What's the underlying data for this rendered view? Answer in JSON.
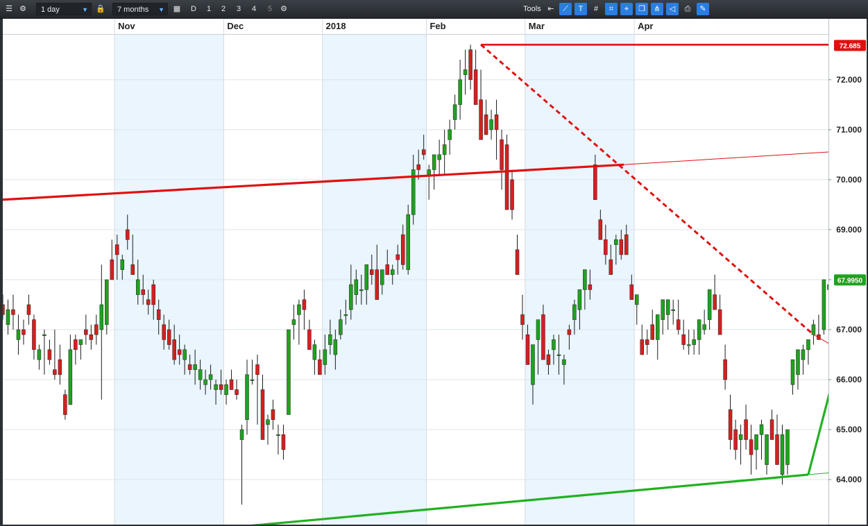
{
  "toolbar": {
    "interval": "1 day",
    "period": "7 months",
    "tools_label": "Tools",
    "period_buttons": [
      "D",
      "1",
      "2",
      "3",
      "4",
      "5"
    ]
  },
  "colors": {
    "up": "#1fa21f",
    "down": "#d42020",
    "resistance": "#e01010",
    "support": "#22b022",
    "band": "#eaf5fd",
    "grid": "#dde3ea"
  },
  "chart_data": {
    "type": "candlestick",
    "x_labels": [
      "Nov",
      "Dec",
      "2018",
      "Feb",
      "Mar",
      "Apr"
    ],
    "y_ticks": [
      "64.000",
      "65.000",
      "66.000",
      "67.000",
      "68.000",
      "69.000",
      "70.000",
      "71.000",
      "72.000"
    ],
    "ylim": [
      63.1,
      72.9
    ],
    "price_tags": [
      {
        "label": "72.685",
        "value": 72.685,
        "color": "#e01010"
      },
      {
        "label": "67.9950",
        "value": 67.995,
        "color": "#1fa21f"
      }
    ],
    "month_starts": [
      22,
      43,
      62,
      82,
      101,
      122
    ],
    "shaded_months": [
      [
        22,
        43
      ],
      [
        62,
        82
      ],
      [
        101,
        122
      ]
    ],
    "candles": [
      [
        67.5,
        67.7,
        67.2,
        67.3
      ],
      [
        67.1,
        67.6,
        66.9,
        67.4
      ],
      [
        67.4,
        67.7,
        67.0,
        67.3
      ],
      [
        66.8,
        67.3,
        66.5,
        67.0
      ],
      [
        67.0,
        67.2,
        66.7,
        66.9
      ],
      [
        67.5,
        67.7,
        67.1,
        67.3
      ],
      [
        67.2,
        67.3,
        66.4,
        66.6
      ],
      [
        66.4,
        66.7,
        66.2,
        66.6
      ],
      [
        66.9,
        67.0,
        66.1,
        66.9
      ],
      [
        66.6,
        66.8,
        66.3,
        66.4
      ],
      [
        66.2,
        67.0,
        66.0,
        66.1
      ],
      [
        66.4,
        66.7,
        65.9,
        66.1
      ],
      [
        65.7,
        65.8,
        65.2,
        65.3
      ],
      [
        65.5,
        66.9,
        65.5,
        66.6
      ],
      [
        66.8,
        66.9,
        66.3,
        66.6
      ],
      [
        66.7,
        66.8,
        66.4,
        66.8
      ],
      [
        67.0,
        67.3,
        66.7,
        66.9
      ],
      [
        66.9,
        67.1,
        66.6,
        66.8
      ],
      [
        67.1,
        67.3,
        66.7,
        66.9
      ],
      [
        67.0,
        68.3,
        65.6,
        67.5
      ],
      [
        67.1,
        68.0,
        66.9,
        68.0
      ],
      [
        68.4,
        68.8,
        68.1,
        68.0
      ],
      [
        68.7,
        68.9,
        68.0,
        68.5
      ],
      [
        68.2,
        68.5,
        68.0,
        68.4
      ],
      [
        69.0,
        69.3,
        68.6,
        68.8
      ],
      [
        68.3,
        68.9,
        68.1,
        68.1
      ],
      [
        67.7,
        68.4,
        67.5,
        68.0
      ],
      [
        67.8,
        68.1,
        67.5,
        67.7
      ],
      [
        67.6,
        67.8,
        67.3,
        67.5
      ],
      [
        67.9,
        68.0,
        67.2,
        67.5
      ],
      [
        67.4,
        67.6,
        66.9,
        67.2
      ],
      [
        67.1,
        67.3,
        66.6,
        66.8
      ],
      [
        67.0,
        67.2,
        66.6,
        66.7
      ],
      [
        66.8,
        67.1,
        66.3,
        66.4
      ],
      [
        66.6,
        66.9,
        66.3,
        66.5
      ],
      [
        66.4,
        66.7,
        66.1,
        66.6
      ],
      [
        66.3,
        66.5,
        66.1,
        66.2
      ],
      [
        66.2,
        66.6,
        65.9,
        66.3
      ],
      [
        66.0,
        66.4,
        65.8,
        66.2
      ],
      [
        65.9,
        66.2,
        65.7,
        66.0
      ],
      [
        66.0,
        66.3,
        65.8,
        66.1
      ],
      [
        65.8,
        66.0,
        65.5,
        65.9
      ],
      [
        65.9,
        66.2,
        65.7,
        65.8
      ],
      [
        65.7,
        66.0,
        65.5,
        65.9
      ],
      [
        66.0,
        66.2,
        65.8,
        65.8
      ],
      [
        65.8,
        66.0,
        65.6,
        65.7
      ],
      [
        64.8,
        65.1,
        63.5,
        65.0
      ],
      [
        65.2,
        66.4,
        64.9,
        66.1
      ],
      [
        66.0,
        66.4,
        65.9,
        66.0
      ],
      [
        66.3,
        66.5,
        65.1,
        66.1
      ],
      [
        65.8,
        66.1,
        64.8,
        64.8
      ],
      [
        65.1,
        65.3,
        64.7,
        65.2
      ],
      [
        65.4,
        65.6,
        65.0,
        65.2
      ],
      [
        64.9,
        65.1,
        64.5,
        64.9
      ],
      [
        64.9,
        65.1,
        64.4,
        64.6
      ],
      [
        65.3,
        67.0,
        65.3,
        67.0
      ],
      [
        67.1,
        67.5,
        66.8,
        67.2
      ],
      [
        67.3,
        67.6,
        66.7,
        67.5
      ],
      [
        67.6,
        67.8,
        67.0,
        67.4
      ],
      [
        67.0,
        67.2,
        66.7,
        66.6
      ],
      [
        66.4,
        66.8,
        66.1,
        66.7
      ],
      [
        66.4,
        66.6,
        66.1,
        66.1
      ],
      [
        66.3,
        66.9,
        66.1,
        66.6
      ],
      [
        66.7,
        67.2,
        66.5,
        66.9
      ],
      [
        66.5,
        67.0,
        66.2,
        66.8
      ],
      [
        66.9,
        67.4,
        66.8,
        67.2
      ],
      [
        67.3,
        67.6,
        67.1,
        67.3
      ],
      [
        67.4,
        68.3,
        67.2,
        67.9
      ],
      [
        67.7,
        68.2,
        67.5,
        68.0
      ],
      [
        67.8,
        68.1,
        67.5,
        67.8
      ],
      [
        67.8,
        68.3,
        67.5,
        68.3
      ],
      [
        68.2,
        68.5,
        67.9,
        68.1
      ],
      [
        68.2,
        68.7,
        67.9,
        67.6
      ],
      [
        67.9,
        68.2,
        67.7,
        68.2
      ],
      [
        68.3,
        68.6,
        68.1,
        68.1
      ],
      [
        68.1,
        68.3,
        67.9,
        68.2
      ],
      [
        68.5,
        68.7,
        68.1,
        68.4
      ],
      [
        68.9,
        69.1,
        68.2,
        68.3
      ],
      [
        68.2,
        69.5,
        68.1,
        69.3
      ],
      [
        69.3,
        70.5,
        69.1,
        70.2
      ],
      [
        70.3,
        70.6,
        70.0,
        70.2
      ],
      [
        70.6,
        70.9,
        70.4,
        70.5
      ],
      [
        70.1,
        70.3,
        69.6,
        70.2
      ],
      [
        70.2,
        70.4,
        69.8,
        70.5
      ],
      [
        70.4,
        70.8,
        70.1,
        70.5
      ],
      [
        70.5,
        71.0,
        70.1,
        70.7
      ],
      [
        70.8,
        71.2,
        70.5,
        71.0
      ],
      [
        71.2,
        71.7,
        71.0,
        71.5
      ],
      [
        71.5,
        72.4,
        71.2,
        72.0
      ],
      [
        72.1,
        72.6,
        71.7,
        72.2
      ],
      [
        72.6,
        72.7,
        71.8,
        72.0
      ],
      [
        72.2,
        72.6,
        71.7,
        71.5
      ],
      [
        71.6,
        72.2,
        70.9,
        70.8
      ],
      [
        71.3,
        71.6,
        70.9,
        70.9
      ],
      [
        71.0,
        71.4,
        70.8,
        71.2
      ],
      [
        71.3,
        71.6,
        70.4,
        71.0
      ],
      [
        70.8,
        71.0,
        69.8,
        70.2
      ],
      [
        70.7,
        70.9,
        70.0,
        69.4
      ],
      [
        70.0,
        70.2,
        69.2,
        69.4
      ],
      [
        68.6,
        68.9,
        68.1,
        68.1
      ],
      [
        67.3,
        67.7,
        66.8,
        67.1
      ],
      [
        66.9,
        67.1,
        66.5,
        66.3
      ],
      [
        65.9,
        66.3,
        65.5,
        66.7
      ],
      [
        66.8,
        67.0,
        66.1,
        67.2
      ],
      [
        67.3,
        67.5,
        66.4,
        66.4
      ],
      [
        66.5,
        66.6,
        66.1,
        66.3
      ],
      [
        66.6,
        66.9,
        66.3,
        66.8
      ],
      [
        66.5,
        66.9,
        66.1,
        66.5
      ],
      [
        66.3,
        66.5,
        65.9,
        66.4
      ],
      [
        67.0,
        67.1,
        66.6,
        66.9
      ],
      [
        67.2,
        67.6,
        66.9,
        67.5
      ],
      [
        67.4,
        67.6,
        67.0,
        67.8
      ],
      [
        67.8,
        68.0,
        67.4,
        68.2
      ],
      [
        67.9,
        68.2,
        67.6,
        67.8
      ],
      [
        70.3,
        70.5,
        69.7,
        69.6
      ],
      [
        69.2,
        69.4,
        68.8,
        68.8
      ],
      [
        68.8,
        69.1,
        68.3,
        68.5
      ],
      [
        68.4,
        68.7,
        68.1,
        68.1
      ],
      [
        68.7,
        68.9,
        68.3,
        68.8
      ],
      [
        68.8,
        69.0,
        68.4,
        68.5
      ],
      [
        68.9,
        69.1,
        68.6,
        68.5
      ],
      [
        67.9,
        68.1,
        67.6,
        67.6
      ],
      [
        67.5,
        67.7,
        67.1,
        67.7
      ],
      [
        66.8,
        67.1,
        66.5,
        66.5
      ],
      [
        66.8,
        67.0,
        66.5,
        66.7
      ],
      [
        67.1,
        67.4,
        66.8,
        66.8
      ],
      [
        66.8,
        67.3,
        66.4,
        67.3
      ],
      [
        67.2,
        67.4,
        66.9,
        67.6
      ],
      [
        67.3,
        67.6,
        67.0,
        67.6
      ],
      [
        67.4,
        67.6,
        67.1,
        67.4
      ],
      [
        67.2,
        67.6,
        66.9,
        67.0
      ],
      [
        66.9,
        67.2,
        66.6,
        66.7
      ],
      [
        66.7,
        67.0,
        66.5,
        66.7
      ],
      [
        66.7,
        67.0,
        66.5,
        66.8
      ],
      [
        66.8,
        67.2,
        66.5,
        67.2
      ],
      [
        67.0,
        67.4,
        66.9,
        67.1
      ],
      [
        67.2,
        67.6,
        67.0,
        67.8
      ],
      [
        67.7,
        68.1,
        67.4,
        67.4
      ],
      [
        67.4,
        67.7,
        67.0,
        66.9
      ],
      [
        66.4,
        66.7,
        65.8,
        66.0
      ],
      [
        65.4,
        65.7,
        64.6,
        64.8
      ],
      [
        65.0,
        65.2,
        64.4,
        64.6
      ],
      [
        64.8,
        65.1,
        64.3,
        64.9
      ],
      [
        65.2,
        65.5,
        64.6,
        64.8
      ],
      [
        64.8,
        65.1,
        64.1,
        64.5
      ],
      [
        64.6,
        64.9,
        64.2,
        64.9
      ],
      [
        64.9,
        65.2,
        64.4,
        65.1
      ],
      [
        64.3,
        64.6,
        64.1,
        64.9
      ],
      [
        65.2,
        65.4,
        64.8,
        64.8
      ],
      [
        64.9,
        65.3,
        64.3,
        64.3
      ],
      [
        64.1,
        65.1,
        63.9,
        64.9
      ],
      [
        64.3,
        64.8,
        64.1,
        65.0
      ],
      [
        65.9,
        66.2,
        65.7,
        66.4
      ],
      [
        66.1,
        66.4,
        65.8,
        66.6
      ],
      [
        66.4,
        66.7,
        66.1,
        66.6
      ],
      [
        66.6,
        66.8,
        66.3,
        66.8
      ],
      [
        66.9,
        67.2,
        66.7,
        67.1
      ],
      [
        66.9,
        67.3,
        66.8,
        66.8
      ],
      [
        67.0,
        68.0,
        66.9,
        68.0
      ],
      [
        67.8,
        68.1,
        67.6,
        67.9
      ]
    ],
    "trendlines": [
      {
        "kind": "resistance",
        "style": "solid-thick",
        "from": [
          0,
          69.6
        ],
        "to": [
          119.5,
          70.3
        ]
      },
      {
        "kind": "resistance",
        "style": "solid-thin",
        "from": [
          119.5,
          70.3
        ],
        "to": [
          166,
          70.6
        ]
      },
      {
        "kind": "resistance",
        "style": "dashed",
        "from": [
          92,
          72.7
        ],
        "to": [
          156,
          66.9
        ]
      },
      {
        "kind": "resistance",
        "style": "solid-thin",
        "from": [
          156,
          66.9
        ],
        "to": [
          166,
          66.3
        ]
      },
      {
        "kind": "resistance",
        "style": "solid-medium",
        "from": [
          92,
          72.7
        ],
        "to": [
          166,
          72.7
        ]
      },
      {
        "kind": "support",
        "style": "solid-thick",
        "from": [
          29,
          62.9
        ],
        "to": [
          155,
          64.1
        ]
      },
      {
        "kind": "support",
        "style": "solid-thin",
        "from": [
          155,
          64.1
        ],
        "to": [
          166,
          64.2
        ]
      },
      {
        "kind": "support",
        "style": "solid-thick",
        "from": [
          155,
          64.1
        ],
        "to": [
          162,
          66.9
        ]
      },
      {
        "kind": "support",
        "style": "solid-thin",
        "from": [
          162,
          66.9
        ],
        "to": [
          166,
          68.5
        ]
      }
    ]
  }
}
